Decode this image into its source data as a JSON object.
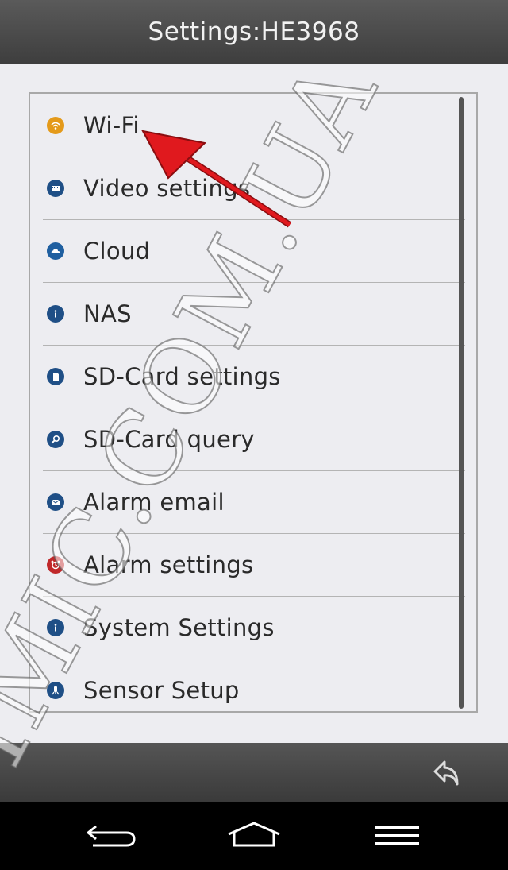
{
  "header": {
    "title": "Settings:HE3968"
  },
  "menu": {
    "items": [
      {
        "label": "Wi-Fi",
        "icon": "wifi-icon",
        "color": "#e49a1a"
      },
      {
        "label": "Video settings",
        "icon": "video-icon",
        "color": "#1f4f86"
      },
      {
        "label": "Cloud",
        "icon": "cloud-icon",
        "color": "#1f5fa0"
      },
      {
        "label": "NAS",
        "icon": "info-icon",
        "color": "#1f4f86"
      },
      {
        "label": "SD-Card settings",
        "icon": "sd-card-icon",
        "color": "#1f4f86"
      },
      {
        "label": "SD-Card query",
        "icon": "search-icon",
        "color": "#1f4f86"
      },
      {
        "label": "Alarm email",
        "icon": "mail-icon",
        "color": "#1f4f86"
      },
      {
        "label": "Alarm settings",
        "icon": "alarm-clock-icon",
        "color": "#c0282a"
      },
      {
        "label": "System Settings",
        "icon": "info-icon",
        "color": "#1f4f86"
      },
      {
        "label": "Sensor Setup",
        "icon": "sensor-icon",
        "color": "#1f4f86"
      }
    ]
  },
  "bottombar": {
    "back_icon": "undo-arrow-icon"
  },
  "navbar": {
    "back_icon": "back-icon",
    "home_icon": "home-icon",
    "menu_icon": "menu-icon"
  },
  "watermark": {
    "text": "MMIC.COM.UA"
  },
  "annotation": {
    "arrow_color": "#e0191e"
  }
}
